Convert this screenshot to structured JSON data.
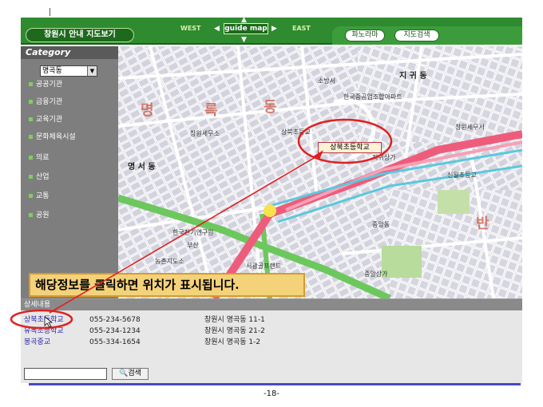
{
  "header": {
    "title": "창원시 안내 지도보기",
    "compass": {
      "west": "WEST",
      "east": "EAST",
      "center": "guide map"
    },
    "buttons": {
      "panorama": "파노라마",
      "map_search": "지도검색"
    }
  },
  "sidebar": {
    "heading": "Category",
    "select_value": "명곡동",
    "items": [
      "공공기관",
      "금융기관",
      "교육기관",
      "문화체육시설",
      "의료",
      "산업",
      "교통",
      "공원"
    ]
  },
  "map": {
    "districts": [
      "명",
      "륵",
      "동",
      "반",
      "지 귀 동",
      "명 서 동"
    ],
    "labels": [
      "한국중공업조합아파트",
      "소방서",
      "상북초등교",
      "창원세무서",
      "창원세무소",
      "신월초등교",
      "한국전기연구원",
      "농촌지도소",
      "부산",
      "서광골프랜드",
      "중앙동",
      "중앙상가",
      "지귀상가"
    ],
    "target": "상북초등학교"
  },
  "banner": "해당정보를 클릭하면 위치가 표시됩니다.",
  "detail": {
    "heading": "상세내용",
    "rows": [
      {
        "name": "상북초등학교",
        "phone": "055-234-5678",
        "addr": "창원시 명곡동 11-1"
      },
      {
        "name": "유목초등학교",
        "phone": "055-234-1234",
        "addr": "창원시 명곡동 21-2"
      },
      {
        "name": "봉곡중교",
        "phone": "055-334-1654",
        "addr": "창원시 명곡동 1-2"
      }
    ],
    "search_value": "",
    "search_button": "검색"
  },
  "page_number": "-18-",
  "colors": {
    "header": "#2f8b2f",
    "banner": "#f4d27a",
    "annotation": "#e02020",
    "link": "#2a2ab0"
  }
}
